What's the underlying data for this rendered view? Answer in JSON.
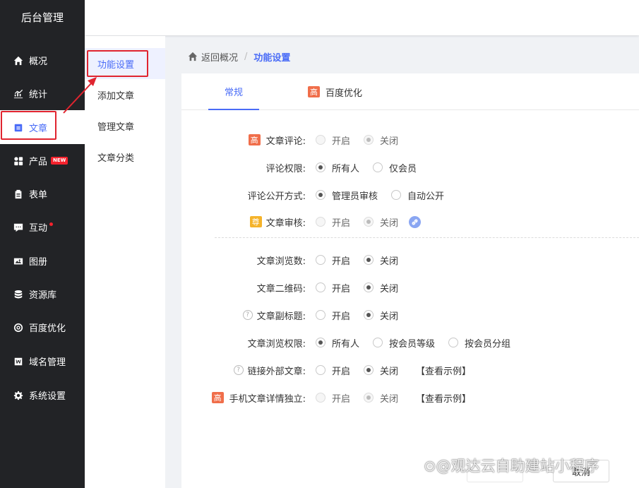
{
  "app": {
    "title": "后台管理"
  },
  "sidebar": {
    "items": [
      {
        "label": "概况",
        "icon": "home-icon"
      },
      {
        "label": "统计",
        "icon": "chart-icon"
      },
      {
        "label": "文章",
        "icon": "article-icon",
        "active": true
      },
      {
        "label": "产品",
        "icon": "grid-icon",
        "badge": "NEW"
      },
      {
        "label": "表单",
        "icon": "clipboard-icon"
      },
      {
        "label": "互动",
        "icon": "chat-icon",
        "dot": true
      },
      {
        "label": "图册",
        "icon": "image-icon"
      },
      {
        "label": "资源库",
        "icon": "database-icon"
      },
      {
        "label": "百度优化",
        "icon": "target-icon"
      },
      {
        "label": "域名管理",
        "icon": "w-icon"
      },
      {
        "label": "系统设置",
        "icon": "gear-icon"
      }
    ]
  },
  "submenu": {
    "items": [
      {
        "label": "功能设置",
        "active": true
      },
      {
        "label": "添加文章"
      },
      {
        "label": "管理文章"
      },
      {
        "label": "文章分类"
      }
    ]
  },
  "breadcrumb": {
    "back": "返回概况",
    "separator": "/",
    "current": "功能设置"
  },
  "tabs": [
    {
      "label": "常规",
      "active": true
    },
    {
      "label": "百度优化",
      "tag": "高"
    }
  ],
  "form": {
    "rows": [
      {
        "tag": "高",
        "label": "文章评论:",
        "options": [
          "开启",
          "关闭"
        ]
      },
      {
        "label": "评论权限:",
        "options": [
          "所有人",
          "仅会员"
        ]
      },
      {
        "label": "评论公开方式:",
        "options": [
          "管理员审核",
          "自动公开"
        ]
      },
      {
        "tag": "尊",
        "label": "文章审核:",
        "options": [
          "开启",
          "关闭"
        ]
      },
      {
        "label": "文章浏览数:",
        "options": [
          "开启",
          "关闭"
        ]
      },
      {
        "label": "文章二维码:",
        "options": [
          "开启",
          "关闭"
        ]
      },
      {
        "help": "?",
        "label": "文章副标题:",
        "options": [
          "开启",
          "关闭"
        ]
      },
      {
        "label": "文章浏览权限:",
        "options": [
          "所有人",
          "按会员等级",
          "按会员分组"
        ]
      },
      {
        "help": "?",
        "label": "链接外部文章:",
        "options": [
          "开启",
          "关闭"
        ],
        "link": "【查看示例】"
      },
      {
        "tag": "高",
        "label": "手机文章详情独立:",
        "options": [
          "开启",
          "关闭"
        ],
        "link": "【查看示例】"
      }
    ]
  },
  "footer": {
    "cancel": "取消"
  },
  "watermark": "⊙@观达云自助建站小程序",
  "colors": {
    "sidebar": "#222326",
    "accent": "#4a6cf7",
    "highlight_box": "#e0242f",
    "tag_gao": "#f06e4a",
    "tag_zun": "#f5b32a"
  }
}
